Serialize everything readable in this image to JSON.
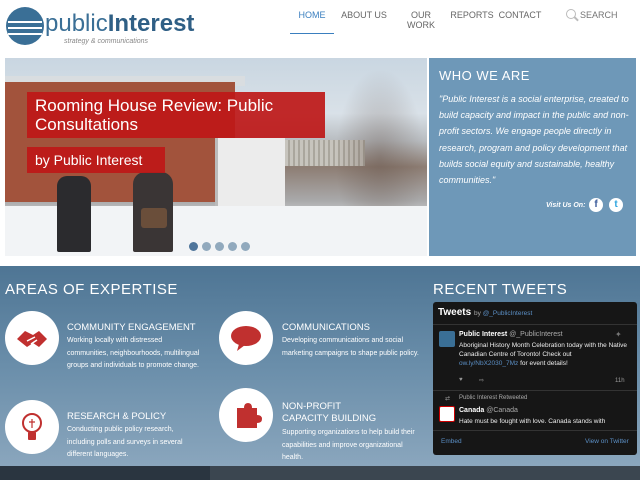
{
  "brand": {
    "name_light": "public",
    "name_bold": "Interest",
    "tagline": "strategy & communications"
  },
  "nav": {
    "items": [
      {
        "label": "HOME",
        "active": true
      },
      {
        "label": "ABOUT US",
        "active": false
      },
      {
        "label": "OUR WORK",
        "active": false
      },
      {
        "label": "REPORTS",
        "active": false
      },
      {
        "label": "CONTACT",
        "active": false
      }
    ],
    "search_placeholder": "SEARCH"
  },
  "hero": {
    "title": "Rooming House Review: Public Consultations",
    "subtitle": "by Public Interest",
    "slide_count": 5,
    "active_slide": 1
  },
  "who": {
    "title": "WHO WE ARE",
    "text": "\"Public Interest is a social enterprise, created to build capacity and impact in the public and non-profit sectors.  We engage people directly in research, program and policy development that builds social equity and sustainable, healthy communities.\"",
    "visit_label": "Visit Us On:",
    "facebook_icon": "facebook-icon",
    "twitter_icon": "twitter-icon"
  },
  "areas": {
    "title": "AREAS OF EXPERTISE",
    "items": [
      {
        "icon": "handshake-icon",
        "title": "COMMUNITY ENGAGEMENT",
        "text": "Working locally with distressed communities, neighbourhoods, multilingual groups and individuals to promote change."
      },
      {
        "icon": "speech-bubble-icon",
        "title": "COMMUNICATIONS",
        "text": "Developing communications and social marketing campaigns to shape public policy."
      },
      {
        "icon": "lightbulb-icon",
        "title": "RESEARCH & POLICY",
        "text": "Conducting public policy research, including polls and surveys in several different languages."
      },
      {
        "icon": "puzzle-icon",
        "title_line1": "NON-PROFIT",
        "title_line2": "CAPACITY BUILDING",
        "text": "Supporting organizations to help build their capabilities and improve organizational health."
      }
    ]
  },
  "tweets": {
    "title": "RECENT TWEETS",
    "widget_title": "Tweets",
    "by": "by",
    "by_handle": "@_PublicInterest",
    "tweet1": {
      "name": "Public Interest",
      "handle": "@_PublicInterest",
      "text": "Aboriginal History Month Celebration today with the Native Canadian Centre of Toronto! Check out",
      "link": "ow.ly/NbX2030_7Mz",
      "text_after": "for event details!",
      "time": "11h"
    },
    "retweet_label": "Public Interest Retweeted",
    "tweet2": {
      "name": "Canada",
      "handle": "@Canada",
      "text": "Hate must be fought with love. Canada stands with"
    },
    "embed_label": "Embed",
    "view_label": "View on Twitter",
    "colors": {
      "link": "#5b8fc5",
      "widget_bg": "#161616"
    }
  },
  "colors": {
    "accent_red": "#be1818",
    "brand_blue": "#3a6f96",
    "panel_blue": "#6e98b8"
  }
}
